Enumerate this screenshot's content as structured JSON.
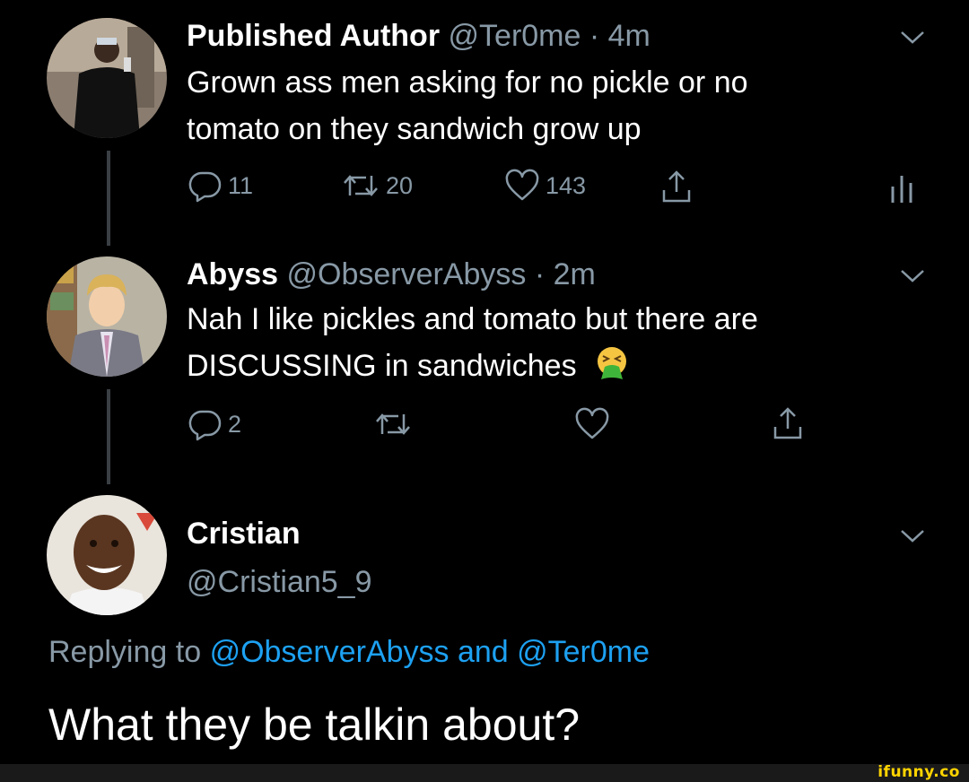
{
  "tweets": [
    {
      "name": "Published Author",
      "handle": "@Ter0me · 4m",
      "text_line1": "Grown ass men asking for no pickle or no",
      "text_line2": "tomato on they sandwich grow up",
      "replies": "11",
      "retweets": "20",
      "likes": "143"
    },
    {
      "name": "Abyss",
      "handle": "@ObserverAbyss · 2m",
      "text_line1": "Nah I like pickles and tomato but there are",
      "text_line2": "DISCUSSING in sandwiches",
      "emoji_icon": "vomiting-face-icon",
      "replies": "2"
    }
  ],
  "reply": {
    "name": "Cristian",
    "handle": "@Cristian5_9",
    "replying_prefix": "Replying to",
    "replying_to_1": "@ObserverAbyss",
    "replying_join": "and",
    "replying_to_2": "@Ter0me",
    "text": "What they be talkin about?"
  },
  "watermark": "ifunny.co",
  "colors": {
    "background": "#000000",
    "secondary_text": "#8899a6",
    "link": "#1da1f2",
    "watermark": "#ffd400"
  }
}
